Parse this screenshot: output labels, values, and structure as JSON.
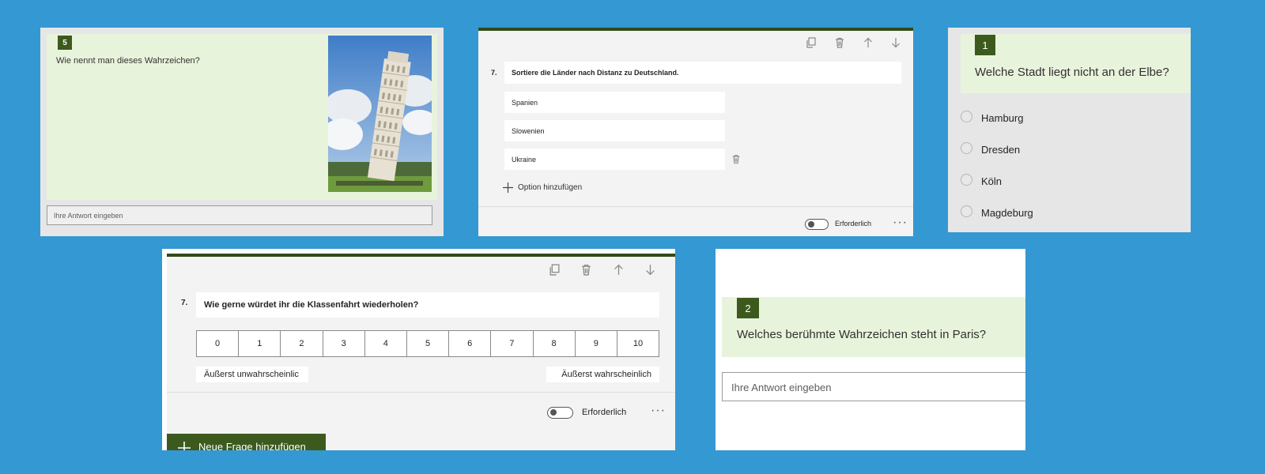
{
  "panel1": {
    "number": "5",
    "question": "Wie nennt man dieses Wahrzeichen?",
    "answer_placeholder": "Ihre Antwort eingeben",
    "image_name": "leaning-tower-of-pisa"
  },
  "panel2": {
    "toolbar": [
      "copy-icon",
      "trash-icon",
      "arrow-up-icon",
      "arrow-down-icon"
    ],
    "number": "7.",
    "question": "Sortiere die Länder nach Distanz zu Deutschland.",
    "options": [
      "Spanien",
      "Slowenien",
      "Ukraine"
    ],
    "add_option": "Option hinzufügen",
    "required_label": "Erforderlich",
    "required_on": false,
    "more": "···"
  },
  "panel3": {
    "number": "1",
    "question": "Welche Stadt liegt nicht an der Elbe?",
    "options": [
      "Hamburg",
      "Dresden",
      "Köln",
      "Magdeburg"
    ]
  },
  "panel4": {
    "toolbar": [
      "copy-icon",
      "trash-icon",
      "arrow-up-icon",
      "arrow-down-icon"
    ],
    "number": "7.",
    "question": "Wie gerne würdet ihr die Klassenfahrt wiederholen?",
    "scale": [
      "0",
      "1",
      "2",
      "3",
      "4",
      "5",
      "6",
      "7",
      "8",
      "9",
      "10"
    ],
    "low_label": "Äußerst unwahrscheinlic",
    "high_label": "Äußerst wahrscheinlich",
    "required_label": "Erforderlich",
    "required_on": false,
    "more": "···",
    "new_question": "Neue Frage hinzufügen"
  },
  "panel5": {
    "number": "2",
    "question": "Welches berühmte Wahrzeichen steht in Paris?",
    "answer_placeholder": "Ihre Antwort eingeben"
  },
  "colors": {
    "background": "#3498d3",
    "accent_green": "#3c5a1e",
    "question_bg": "#e8f3dc"
  }
}
